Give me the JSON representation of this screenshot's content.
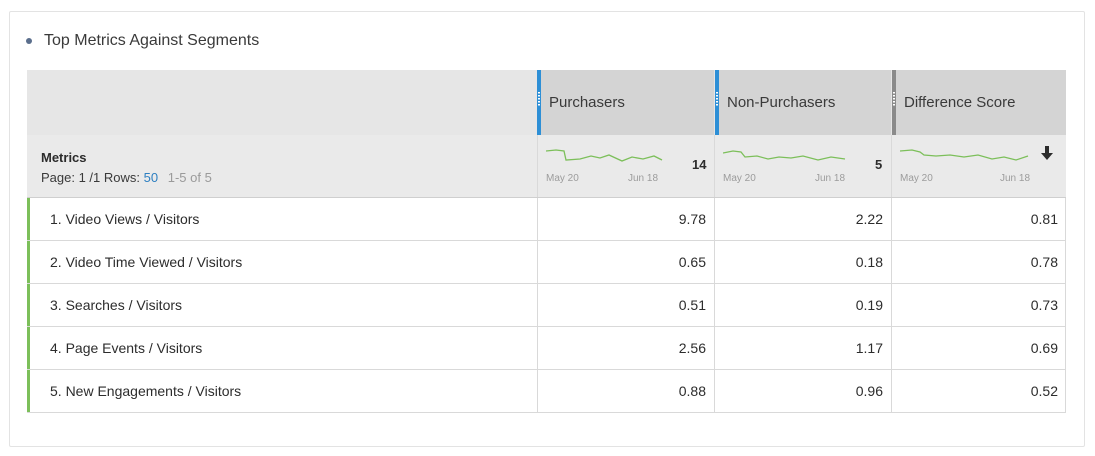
{
  "panel": {
    "title": "Top Metrics Against Segments"
  },
  "segments": [
    {
      "label": "Purchasers",
      "color": "#2d8fd6",
      "total": "14",
      "start_date": "May 20",
      "end_date": "Jun 18"
    },
    {
      "label": "Non-Purchasers",
      "color": "#2d8fd6",
      "total": "5",
      "start_date": "May 20",
      "end_date": "Jun 18"
    },
    {
      "label": "Difference Score",
      "color": "#8a8a8a",
      "total": "",
      "start_date": "May 20",
      "end_date": "Jun 18"
    }
  ],
  "metrics_header": {
    "label": "Metrics",
    "page_text": "Page: 1 /1 Rows:",
    "rows_value": "50",
    "range_text": "1-5 of 5"
  },
  "rows": [
    {
      "label": "1. Video Views / Visitors",
      "values": [
        "9.78",
        "2.22",
        "0.81"
      ]
    },
    {
      "label": "2. Video Time Viewed / Visitors",
      "values": [
        "0.65",
        "0.18",
        "0.78"
      ]
    },
    {
      "label": "3. Searches / Visitors",
      "values": [
        "0.51",
        "0.19",
        "0.73"
      ]
    },
    {
      "label": "4. Page Events / Visitors",
      "values": [
        "2.56",
        "1.17",
        "0.69"
      ]
    },
    {
      "label": "5. New Engagements / Visitors",
      "values": [
        "0.88",
        "0.96",
        "0.52"
      ]
    }
  ],
  "colors": {
    "row_accent": "#7cbf5a",
    "sparkline": "#7cbf5a",
    "link": "#2d7fc1"
  },
  "icons": {
    "sort": "arrow-down-icon",
    "bullet": "bullet-icon"
  }
}
